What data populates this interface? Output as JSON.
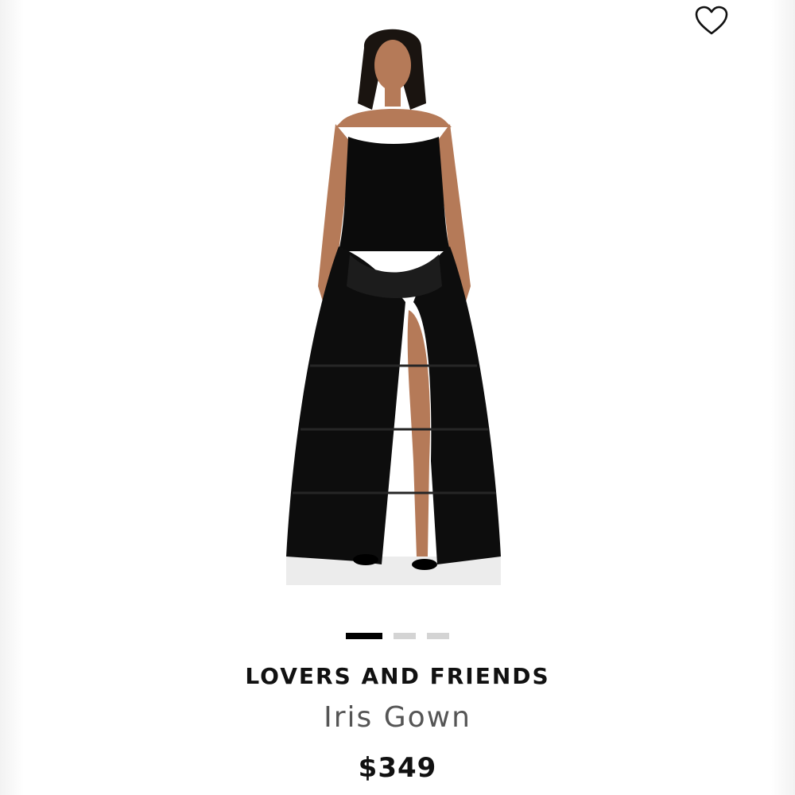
{
  "product": {
    "brand": "LOVERS AND FRIENDS",
    "name": "Iris Gown",
    "price": "$349"
  },
  "wishlist": {
    "icon": "heart-outline-icon"
  },
  "carousel": {
    "total": 3,
    "active_index": 0
  },
  "colors": {
    "dress": "#0b0b0b",
    "dot_active": "#000000",
    "dot_inactive": "#d4d4d4",
    "brand_text": "#111111",
    "name_text": "#555555"
  }
}
